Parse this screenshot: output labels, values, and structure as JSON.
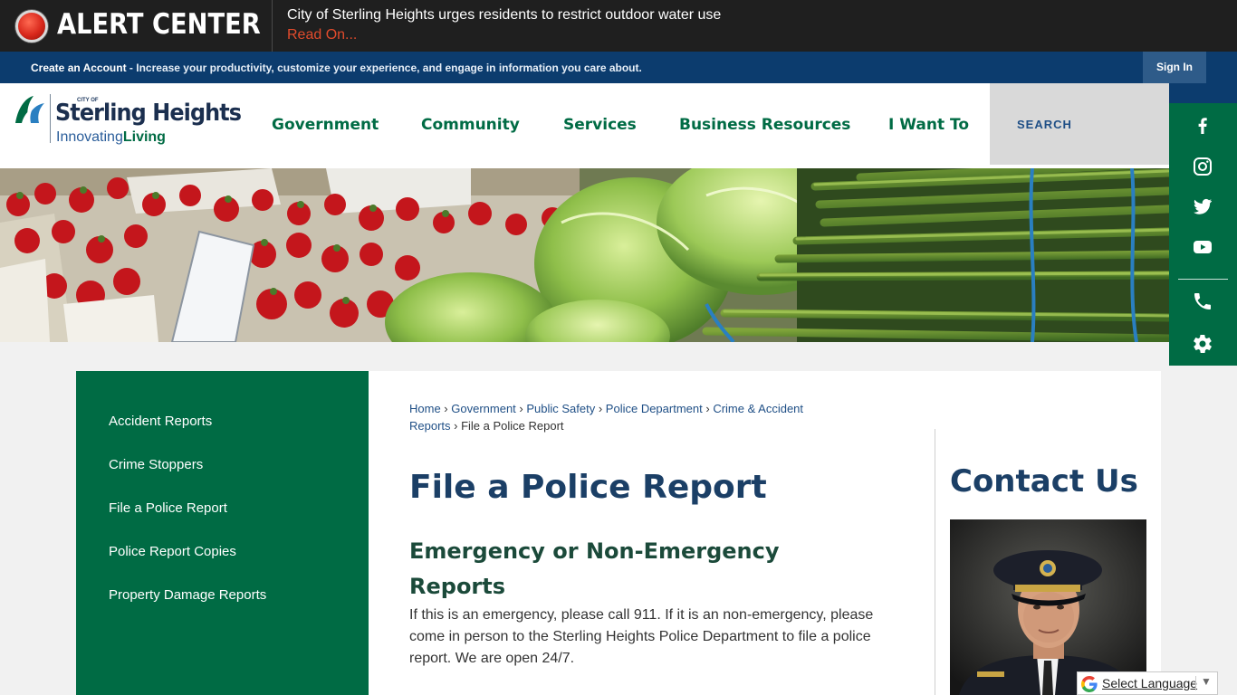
{
  "alert": {
    "title": "ALERT CENTER",
    "headline": "City of Sterling Heights urges residents to restrict outdoor water use",
    "read_on": "Read On..."
  },
  "account_bar": {
    "create_link": "Create an Account",
    "message": " - Increase your productivity, customize your experience, and engage in information you care about.",
    "sign_in": "Sign In"
  },
  "logo": {
    "small": "CITY OF",
    "name": "Sterling Heights",
    "tag_prefix": "Innovating",
    "tag_bold": "Living"
  },
  "nav": {
    "items": [
      "Government",
      "Community",
      "Services",
      "Business Resources",
      "I Want To"
    ]
  },
  "search": {
    "label": "SEARCH"
  },
  "social": {
    "icons": [
      "facebook-icon",
      "instagram-icon",
      "twitter-icon",
      "youtube-icon",
      "phone-icon",
      "gear-icon"
    ]
  },
  "sidenav": {
    "items": [
      "Accident Reports",
      "Crime Stoppers",
      "File a Police Report",
      "Police Report Copies",
      "Property Damage Reports"
    ]
  },
  "breadcrumb": {
    "items": [
      "Home",
      "Government",
      "Public Safety",
      "Police Department",
      "Crime & Accident Reports"
    ],
    "current": "File a Police Report"
  },
  "content": {
    "title": "File a Police Report",
    "subtitle": "Emergency or Non-Emergency Reports",
    "body": "If this is an emergency, please call 911. If it is an non-emergency, please come in person to the Sterling Heights Police Department to file a police report. We are open 24/7."
  },
  "contact": {
    "title": "Contact Us"
  },
  "translate": {
    "label": "Select Language",
    "arrow": "▼"
  },
  "colors": {
    "brand_green": "#006b44",
    "brand_navy": "#0c3c6e",
    "alert_red": "#e14b2c"
  }
}
